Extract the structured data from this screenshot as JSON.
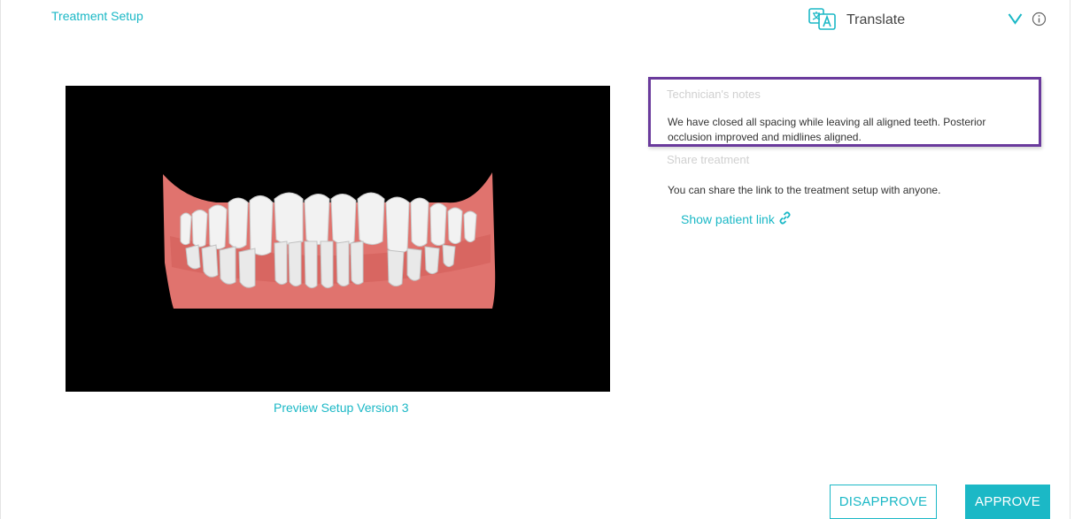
{
  "header": {
    "title": "Treatment Setup",
    "translate_label": "Translate",
    "icons": {
      "translate": "translate-icon",
      "expand": "chevron-down-icon",
      "info": "info-icon"
    }
  },
  "preview": {
    "link_label": "Preview Setup Version 3"
  },
  "technician_notes": {
    "heading": "Technician's notes",
    "text": "We have closed all spacing while leaving all aligned teeth. Posterior occlusion improved and midlines aligned."
  },
  "share": {
    "heading": "Share treatment",
    "description": "You can share the link to the treatment setup with anyone.",
    "link_label": "Show patient link",
    "link_icon": "link-icon"
  },
  "actions": {
    "disapprove_label": "DISAPPROVE",
    "approve_label": "APPROVE"
  },
  "colors": {
    "accent": "#1bb8c6",
    "highlight_border": "#6a3a9c",
    "viewer_background": "#000000",
    "gum": "#e0736e",
    "tooth": "#f2f2f2"
  }
}
